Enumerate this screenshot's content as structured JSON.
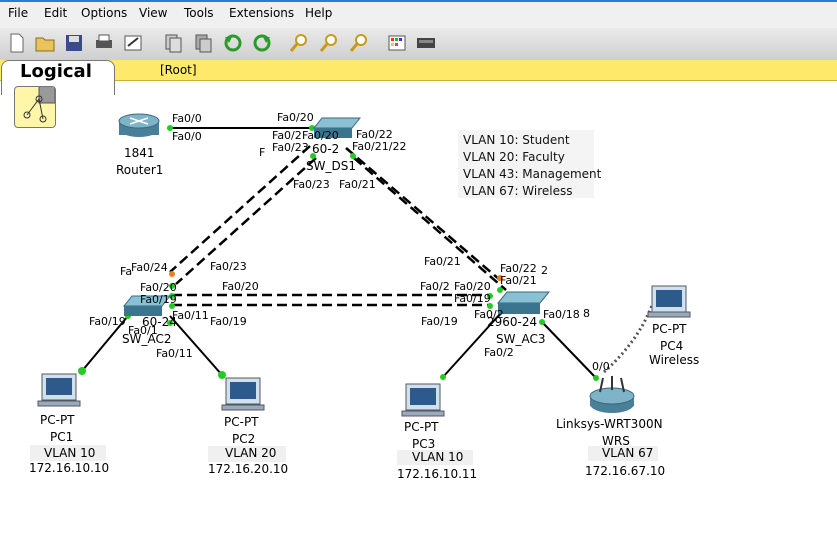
{
  "menu": [
    "File",
    "Edit",
    "Options",
    "View",
    "Tools",
    "Extensions",
    "Help"
  ],
  "workspace": {
    "tab_label": "Logical",
    "root_label": "[Root]"
  },
  "vlan_legend": [
    "VLAN 10: Student",
    "VLAN 20: Faculty",
    "VLAN 43: Management",
    "VLAN 67: Wireless"
  ],
  "devices": {
    "router1": {
      "model": "1841",
      "name": "Router1"
    },
    "sw_ds1": {
      "model_fragment": "60-2",
      "name": "SW_DS1"
    },
    "sw_ac2": {
      "model_fragment": "60-24",
      "name": "SW_AC2"
    },
    "sw_ac3": {
      "model_fragment": "2960-24",
      "name": "SW_AC3"
    },
    "pc1": {
      "type": "PC-PT",
      "name": "PC1",
      "vlan": "VLAN 10",
      "ip": "172.16.10.10"
    },
    "pc2": {
      "type": "PC-PT",
      "name": "PC2",
      "vlan": "VLAN 20",
      "ip": "172.16.20.10"
    },
    "pc3": {
      "type": "PC-PT",
      "name": "PC3",
      "vlan": "VLAN 10",
      "ip": "172.16.10.11"
    },
    "pc4": {
      "type": "PC-PT",
      "name": "PC4",
      "extra": "Wireless"
    },
    "wrs": {
      "model": "Linksys-WRT300N",
      "name": "WRS",
      "vlan": "VLAN 67",
      "ip": "172.16.67.10",
      "port": "0/0"
    }
  },
  "ports": {
    "r1_a": "Fa0/0",
    "r1_b": "Fa0/0",
    "ds1_20": "Fa0/20",
    "ds1_2x": "Fa0/2",
    "ds1_20b": "Fa0/20",
    "ds1_23a": "Fa0/23",
    "ds1_22": "Fa0/22",
    "ds1_2122": "Fa0/21/22",
    "ds1_f": "F",
    "ds1_23b": "Fa0/23",
    "ds1_21": "Fa0/21",
    "ac2_24": "Fa0/24",
    "ac2_20": "Fa0/20",
    "ac2_19": "Fa0/19",
    "ac2_191": "Fa0/19",
    "ac2_1": "Fa0/1",
    "ac2_11": "Fa0/11",
    "ac2_11b": "Fa0/11",
    "ac2_fa": "Fa",
    "mid_23": "Fa0/23",
    "mid_20": "Fa0/20",
    "mid_19": "Fa0/19",
    "ac3_21": "Fa0/21",
    "ac3_22": "Fa0/22",
    "ac3_2": "2",
    "ac3_2x": "Fa0/2",
    "ac3_20": "Fa0/20",
    "ac3_21b": "Fa0/21",
    "ac3_19": "Fa0/19",
    "ac3_19b": "Fa0/19",
    "ac3_2b": "Fa0/2",
    "ac3_18": "Fa0/18",
    "ac3_8": "8",
    "ac3_2c": "Fa0/2"
  }
}
